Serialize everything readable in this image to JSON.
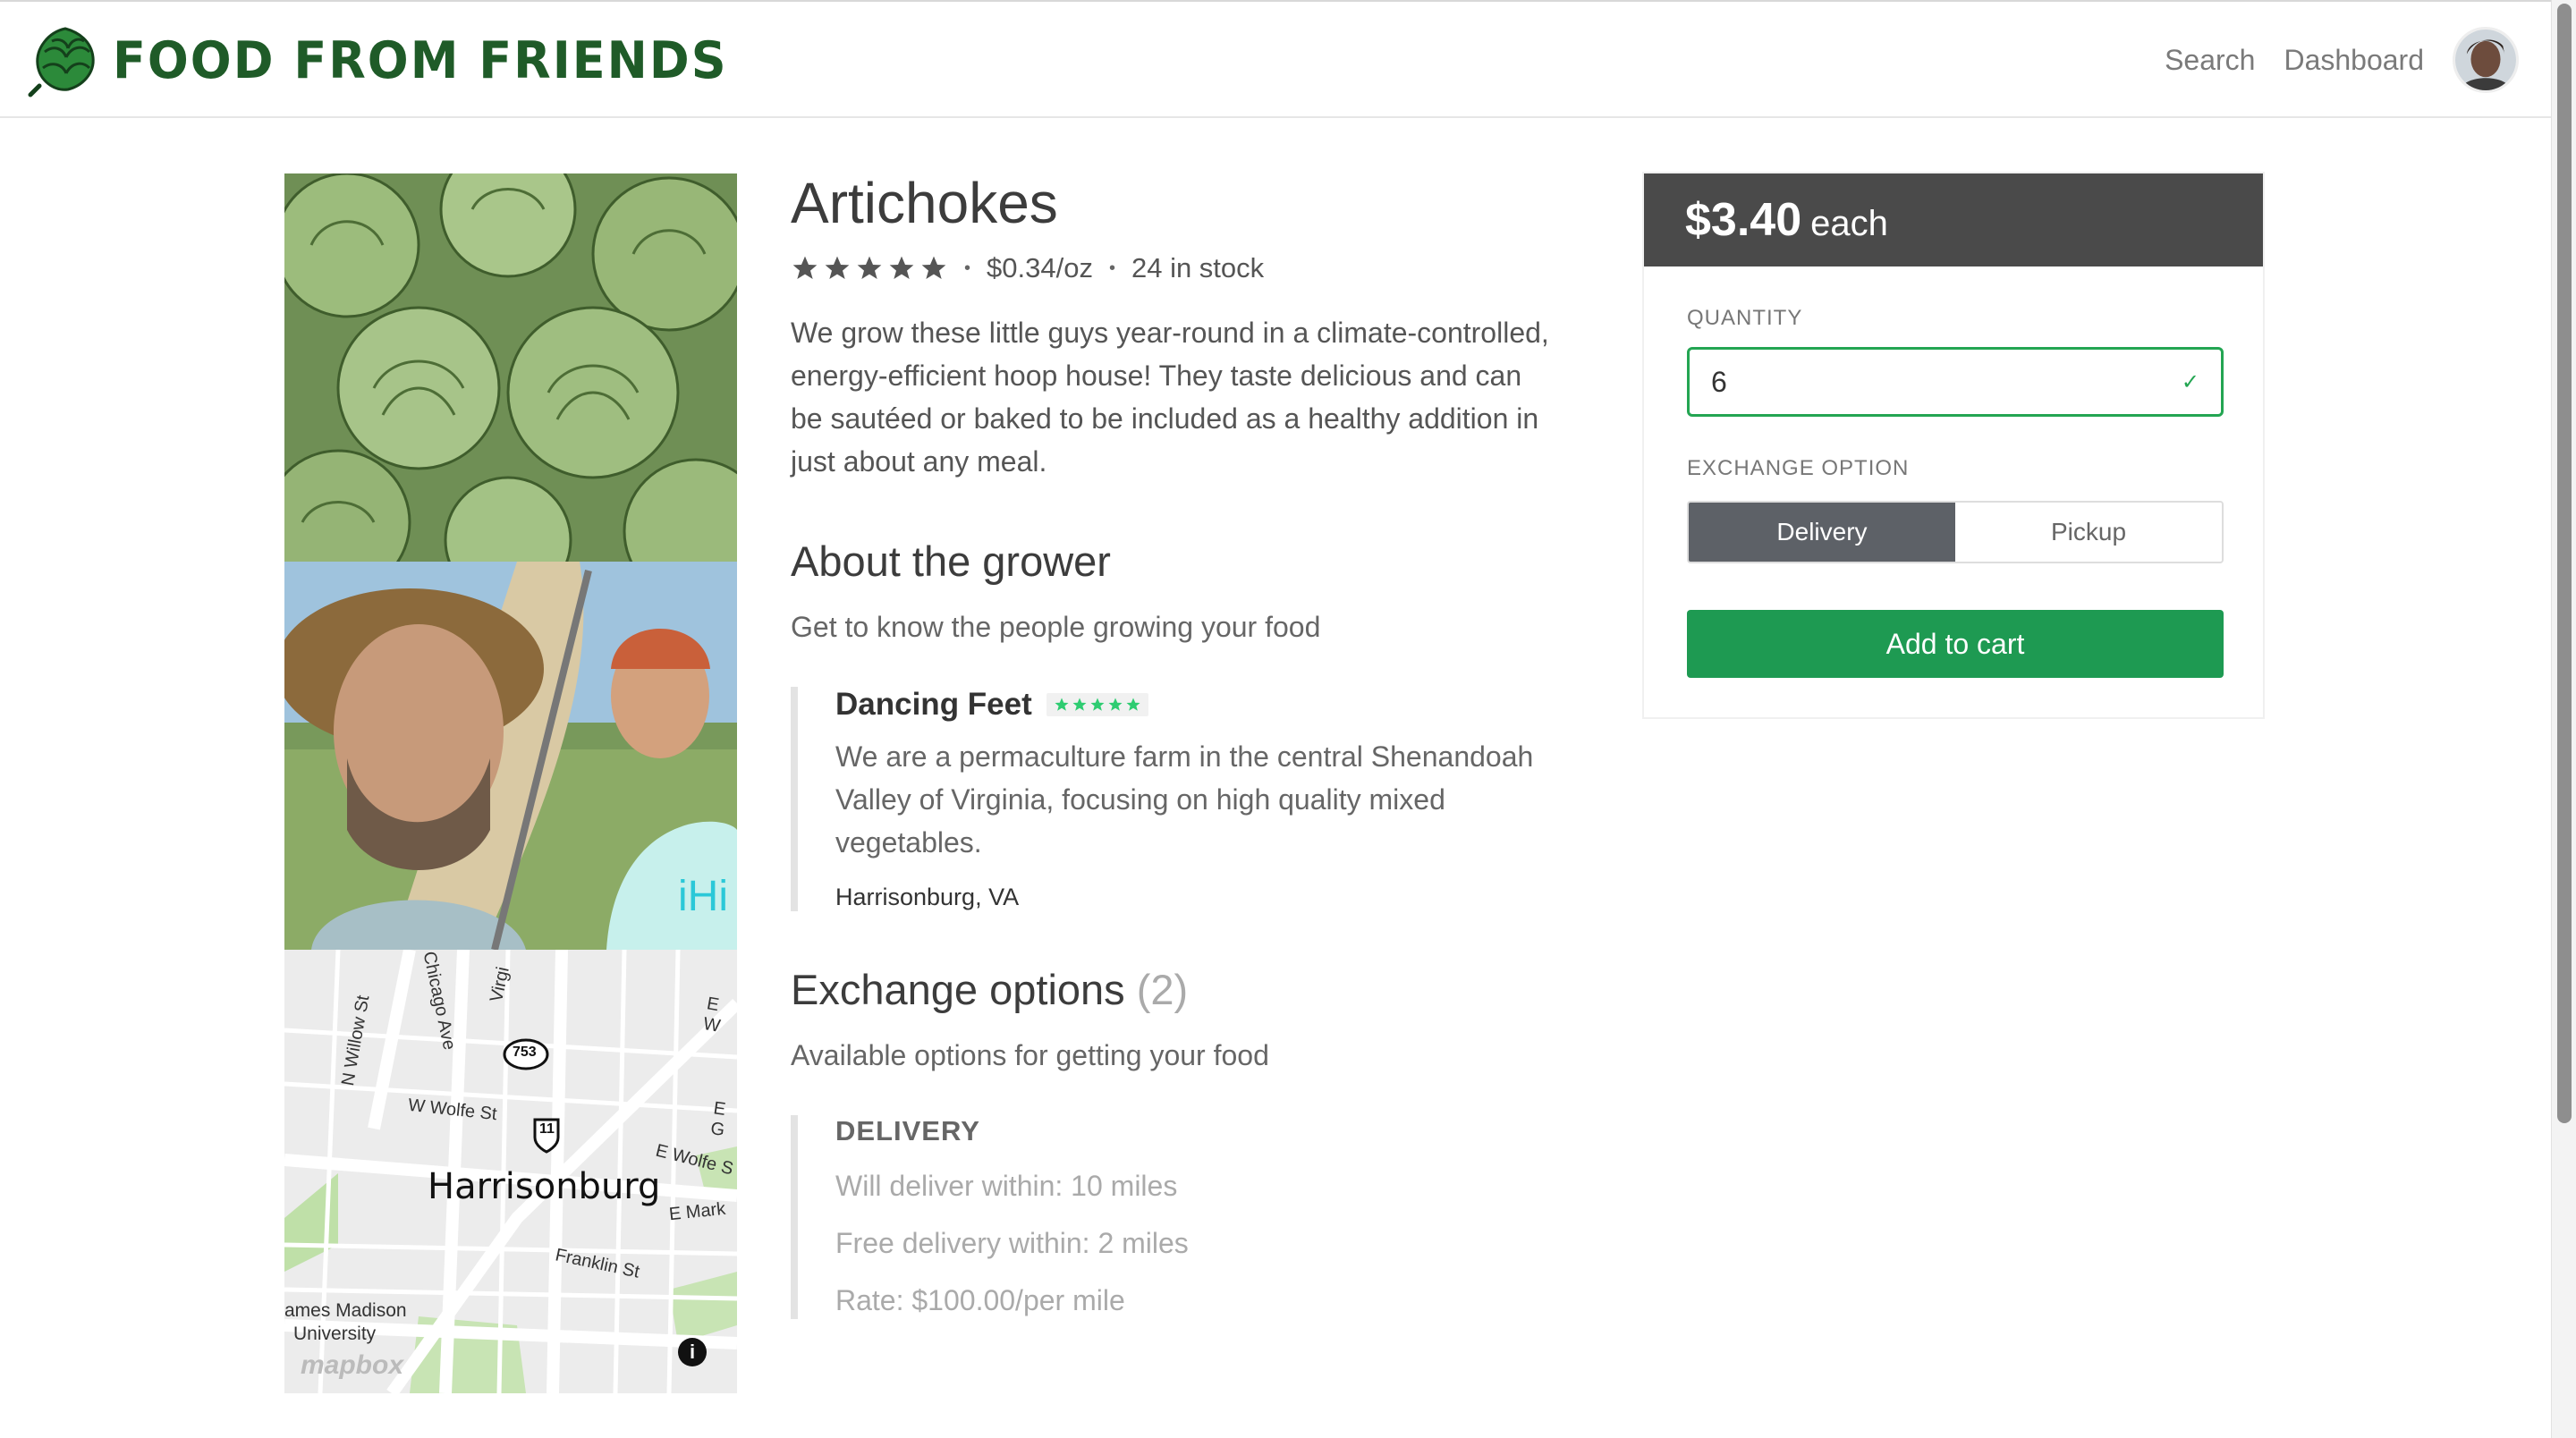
{
  "brand": {
    "name": "FOOD FROM FRIENDS",
    "logo_icon": "artichoke-icon",
    "logo_color": "#1f5b28"
  },
  "nav": {
    "links": [
      "Search",
      "Dashboard"
    ],
    "avatar_icon": "user-avatar"
  },
  "product": {
    "title": "Artichokes",
    "rating": 5,
    "unit_price": "$0.34/oz",
    "stock": "24 in stock",
    "description": "We grow these little guys year-round in a climate-controlled, energy-efficient hoop house! They taste delicious and can be sautéed or baked to be included as a healthy addition in just about any meal."
  },
  "grower_section": {
    "heading": "About the grower",
    "subheading": "Get to know the people growing your food",
    "name": "Dancing Feet",
    "rating": 5,
    "description": "We are a permaculture farm in the central Shenandoah Valley of Virginia, focusing on high quality mixed vegetables.",
    "location": "Harrisonburg, VA"
  },
  "exchange_section": {
    "heading": "Exchange options",
    "count": "(2)",
    "subheading": "Available options for getting your food",
    "delivery": {
      "title": "DELIVERY",
      "lines": [
        "Will deliver within: 10 miles",
        "Free delivery within: 2 miles",
        "Rate: $100.00/per mile"
      ]
    }
  },
  "purchase": {
    "price": "$3.40",
    "price_unit": "each",
    "quantity_label": "QUANTITY",
    "quantity_value": "6",
    "exchange_label": "EXCHANGE OPTION",
    "options": [
      "Delivery",
      "Pickup"
    ],
    "selected_option": "Delivery",
    "add_button": "Add to cart"
  },
  "map": {
    "city": "Harrisonburg",
    "streets": [
      "N Willow St",
      "Chicago Ave",
      "Virgi",
      "E W",
      "W Wolfe St",
      "E G",
      "E Wolfe S",
      "E Mark",
      "Franklin St"
    ],
    "shields": [
      "753",
      "11"
    ],
    "poi": "James Madison University",
    "poi_visible": "ames Madison",
    "poi_line2": "University",
    "attribution": "mapbox"
  },
  "colors": {
    "accent_green": "#1e9a52",
    "dark_header": "#4a4a4a",
    "star_gray": "#555555",
    "star_green": "#2ecc71"
  }
}
